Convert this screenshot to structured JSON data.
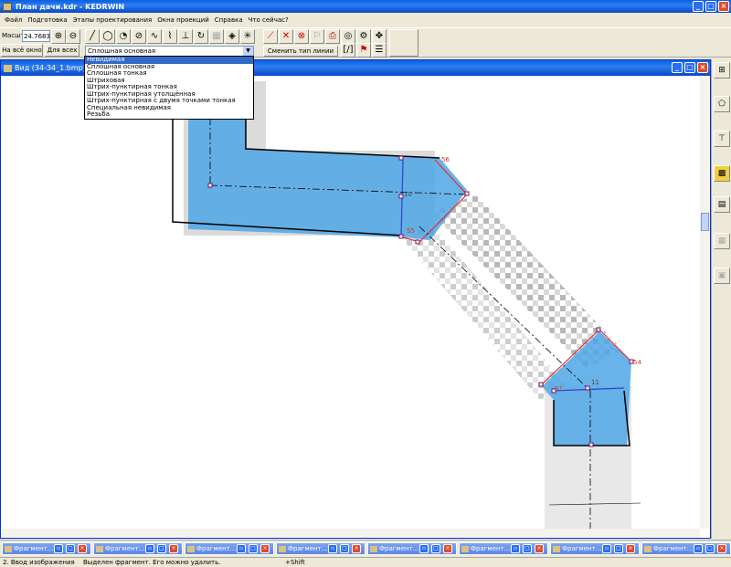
{
  "window": {
    "title": "План дачи.kdr - KEDRWIN"
  },
  "menu": [
    "Файл",
    "Подготовка",
    "Этапы проектирования",
    "Окна проекций",
    "Справка",
    "Что сейчас?"
  ],
  "toolbar": {
    "scale_label": "Масшт",
    "scale_value": "24.7683",
    "fit_all_label": "На всё окно",
    "for_all_label": "Для всех",
    "line_type_selected": "Сплошная основная",
    "change_line_type_label": "Сменить тип линии"
  },
  "line_types": [
    "Невидимая",
    "Сплошная основная",
    "Сплошная тонкая",
    "Штриховая",
    "Штрих-пунктирная тонкая",
    "Штрих-пунктирная утолщённая",
    "Штрих-пунктирная с двумя точками тонкая",
    "Специальная невидимая",
    "Резьба"
  ],
  "highlighted_line_type_index": 0,
  "view_window": {
    "title": "Вид (34-34_1.bmp)"
  },
  "canvas_labels": {
    "p56": "56",
    "p10": "10",
    "p55": "55",
    "p11": "11",
    "p54": "54",
    "p51": "51"
  },
  "fragments": [
    "Фрагмент...",
    "Фрагмент...",
    "Фрагмент...",
    "Фрагмент...",
    "Фрагмент...",
    "Фрагмент...",
    "Фрагмент...",
    "Фрагмент..."
  ],
  "status": {
    "step": "2. Ввод изображения",
    "message": "Выделен фрагмент. Его можно удалить.",
    "modifier": "+Shift"
  },
  "colors": {
    "accent": "#0a5fe0",
    "fill": "#4ea6e6",
    "selection": "#e03030"
  }
}
